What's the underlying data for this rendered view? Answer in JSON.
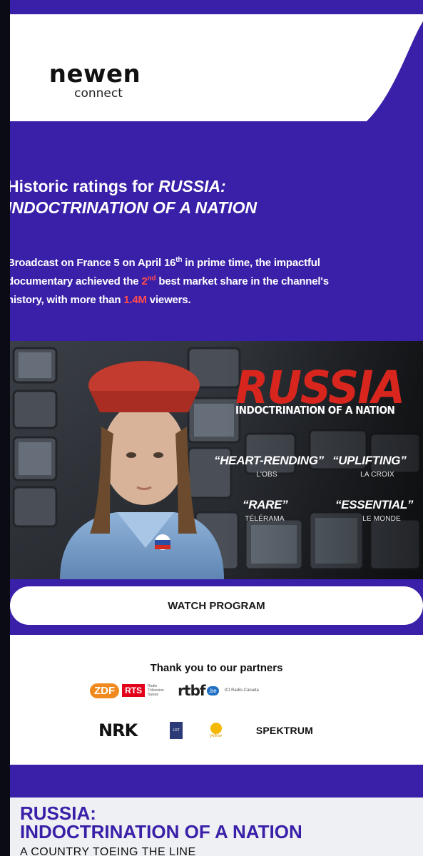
{
  "brand": {
    "name": "newen",
    "sub": "connect"
  },
  "headline": {
    "lead": "Historic ratings for ",
    "title_l1": "RUSSIA:",
    "title_l2": "INDOCTRINATION OF A NATION"
  },
  "lede": {
    "p1": "Broadcast on France 5 on April 16",
    "sup1": "th",
    "p2": " in prime time, the impactful",
    "p3": "documentary achieved the ",
    "hi1": "2",
    "sup2": "nd",
    "p4": " best market share in the channel's",
    "p5": "history, with more than ",
    "hi2": "1.4M",
    "p6": " viewers."
  },
  "poster": {
    "title": "RUSSIA",
    "subtitle": "INDOCTRINATION OF A NATION",
    "quotes": [
      {
        "text": "“HEART-RENDING”",
        "source": "L'OBS"
      },
      {
        "text": "“UPLIFTING”",
        "source": "LA CROIX"
      },
      {
        "text": "“RARE”",
        "source": "TÉLÉRAMA"
      },
      {
        "text": "“ESSENTIAL”",
        "source": "LE MONDE"
      }
    ]
  },
  "cta": {
    "label": "WATCH PROGRAM"
  },
  "partners": {
    "title": "Thank you to our partners",
    "zdf": "ZDF",
    "rts": "RTS",
    "rts_small": "Radio Télévision Suisse",
    "rtbf": "rtbf",
    "rtbf_be": ".be",
    "radio_canada": "ICI Radio-Canada",
    "nrk": "NRK",
    "lrt": "LRT",
    "yellow": "yellow",
    "spektrum": "SPEKTRUM"
  },
  "footer": {
    "title_l1": "RUSSIA:",
    "title_l2": "INDOCTRINATION OF A NATION",
    "subtitle": "A COUNTRY TOEING THE LINE"
  },
  "colors": {
    "purple": "#3a1fa8",
    "accent_red": "#ff4d4d",
    "poster_red": "#d8261e",
    "zdf_orange": "#f08a1e"
  }
}
